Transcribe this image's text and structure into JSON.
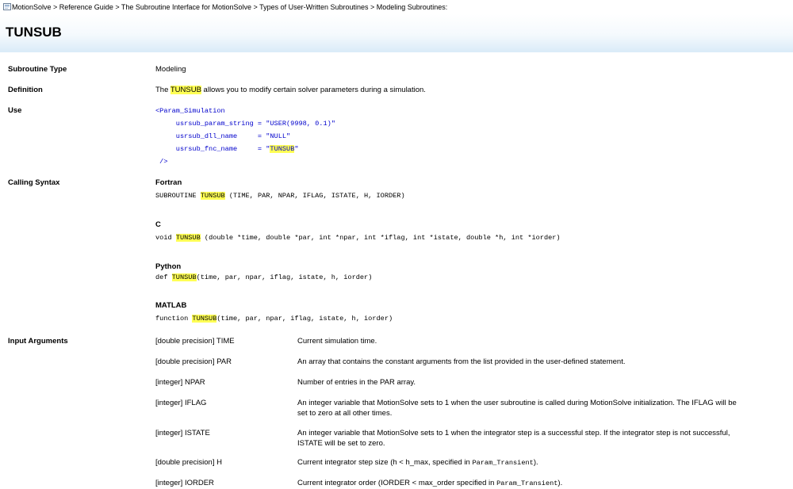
{
  "breadcrumb": {
    "text": "MotionSolve > Reference Guide > The Subroutine Interface for MotionSolve > Types of User-Written Subroutines > Modeling Subroutines:"
  },
  "page": {
    "title": "TUNSUB"
  },
  "subroutine_type": {
    "label": "Subroutine Type",
    "value": "Modeling"
  },
  "definition": {
    "label": "Definition",
    "pre": "The ",
    "highlight": "TUNSUB",
    "post": " allows you to modify certain solver parameters during a simulation."
  },
  "use": {
    "label": "Use",
    "line1": "<Param_Simulation",
    "line2": "     usrsub_param_string = \"USER(9998, 0.1)\"",
    "line3": "     usrsub_dll_name     = \"NULL\"",
    "line4_pre": "     usrsub_fnc_name     = \"",
    "line4_hl": "TUNSUB",
    "line4_post": "\"",
    "line5": " />"
  },
  "calling_syntax": {
    "label": "Calling Syntax",
    "fortran": {
      "heading": "Fortran",
      "pre": "SUBROUTINE ",
      "hl": "TUNSUB",
      "post": " (TIME, PAR, NPAR, IFLAG, ISTATE, H, IORDER)"
    },
    "c": {
      "heading": "C",
      "pre": "void ",
      "hl": "TUNSUB",
      "post": " (double *time, double *par, int *npar, int *iflag, int *istate, double *h, int *iorder)"
    },
    "python": {
      "heading": "Python",
      "pre": "def ",
      "hl": "TUNSUB",
      "post": "(time, par, npar, iflag, istate, h, iorder)"
    },
    "matlab": {
      "heading": "MATLAB",
      "pre": "function ",
      "hl": "TUNSUB",
      "post": "(time, par, npar, iflag, istate, h, iorder)"
    }
  },
  "input_arguments": {
    "label": "Input Arguments",
    "items": [
      {
        "name": "[double precision] TIME",
        "desc": "Current simulation time."
      },
      {
        "name": "[double precision] PAR",
        "desc": "An array that contains the constant arguments from the list provided in the user-defined statement."
      },
      {
        "name": "[integer] NPAR",
        "desc": "Number of entries in the PAR array."
      },
      {
        "name": "[integer] IFLAG",
        "desc": "An integer variable that MotionSolve sets to 1 when the user subroutine is called during MotionSolve initialization.  The IFLAG will be set to zero at all other times."
      },
      {
        "name": "[integer] ISTATE",
        "desc": "An integer variable that MotionSolve sets to 1 when the integrator step is a successful step.  If the integrator step is not successful, ISTATE will be set to zero."
      },
      {
        "name": "[double precision] H",
        "desc_pre": "Current integrator step size (h < h_max, specified in ",
        "desc_code": "Param_Transient",
        "desc_post": ")."
      },
      {
        "name": "[integer] IORDER",
        "desc_pre": "Current integrator order (IORDER < max_order specified in ",
        "desc_code": "Param_Transient",
        "desc_post": ")."
      }
    ]
  }
}
